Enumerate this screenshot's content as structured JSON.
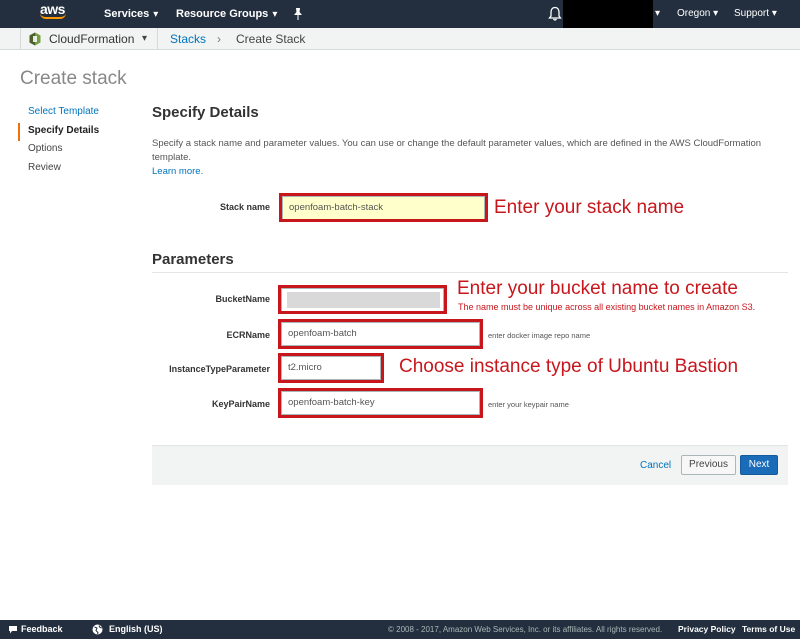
{
  "topnav": {
    "logo_text": "aws",
    "services": "Services",
    "resource_groups": "Resource Groups",
    "region": "Oregon",
    "support": "Support",
    "chevron": "▾"
  },
  "subnav": {
    "service": "CloudFormation",
    "crumb_stacks": "Stacks",
    "crumb_sep": "›",
    "crumb_current": "Create Stack"
  },
  "page_title": "Create stack",
  "steps": [
    {
      "label": "Select Template",
      "state": "link"
    },
    {
      "label": "Specify Details",
      "state": "active"
    },
    {
      "label": "Options",
      "state": "normal"
    },
    {
      "label": "Review",
      "state": "normal"
    }
  ],
  "details": {
    "title": "Specify Details",
    "description": "Specify a stack name and parameter values. You can use or change the default parameter values, which are defined in the AWS CloudFormation template.",
    "learn_more": "Learn more.",
    "stack_name_label": "Stack name",
    "stack_name_value": "openfoam-batch-stack"
  },
  "parameters": {
    "title": "Parameters",
    "bucket_label": "BucketName",
    "bucket_value": "",
    "ecr_label": "ECRName",
    "ecr_value": "openfoam-batch",
    "ecr_hint": "enter docker image repo name",
    "instance_label": "InstanceTypeParameter",
    "instance_value": "t2.micro",
    "keypair_label": "KeyPairName",
    "keypair_value": "openfoam-batch-key",
    "keypair_hint": "enter your keypair name"
  },
  "annotations": {
    "stack": "Enter your stack name",
    "bucket": "Enter your bucket name to create",
    "bucket_note": "The name must be unique across all existing bucket names in Amazon S3.",
    "instance": "Choose instance type of Ubuntu Bastion"
  },
  "actions": {
    "cancel": "Cancel",
    "previous": "Previous",
    "next": "Next"
  },
  "footer": {
    "feedback": "Feedback",
    "language": "English (US)",
    "copyright": "© 2008 - 2017, Amazon Web Services, Inc. or its affiliates. All rights reserved.",
    "privacy": "Privacy Policy",
    "terms": "Terms of Use"
  },
  "colors": {
    "nav_bg": "#232f3e",
    "accent_orange": "#ec7211",
    "link_blue": "#0073bb",
    "annotation_red": "#c7171d",
    "stack_input_bg": "#ffffcc",
    "primary_button": "#1a6bb8"
  },
  "icons": {
    "pin": "pin-icon",
    "bell": "bell-icon",
    "cloudformation": "cloudformation-icon",
    "feedback": "speech-bubble-icon",
    "language": "globe-icon"
  }
}
